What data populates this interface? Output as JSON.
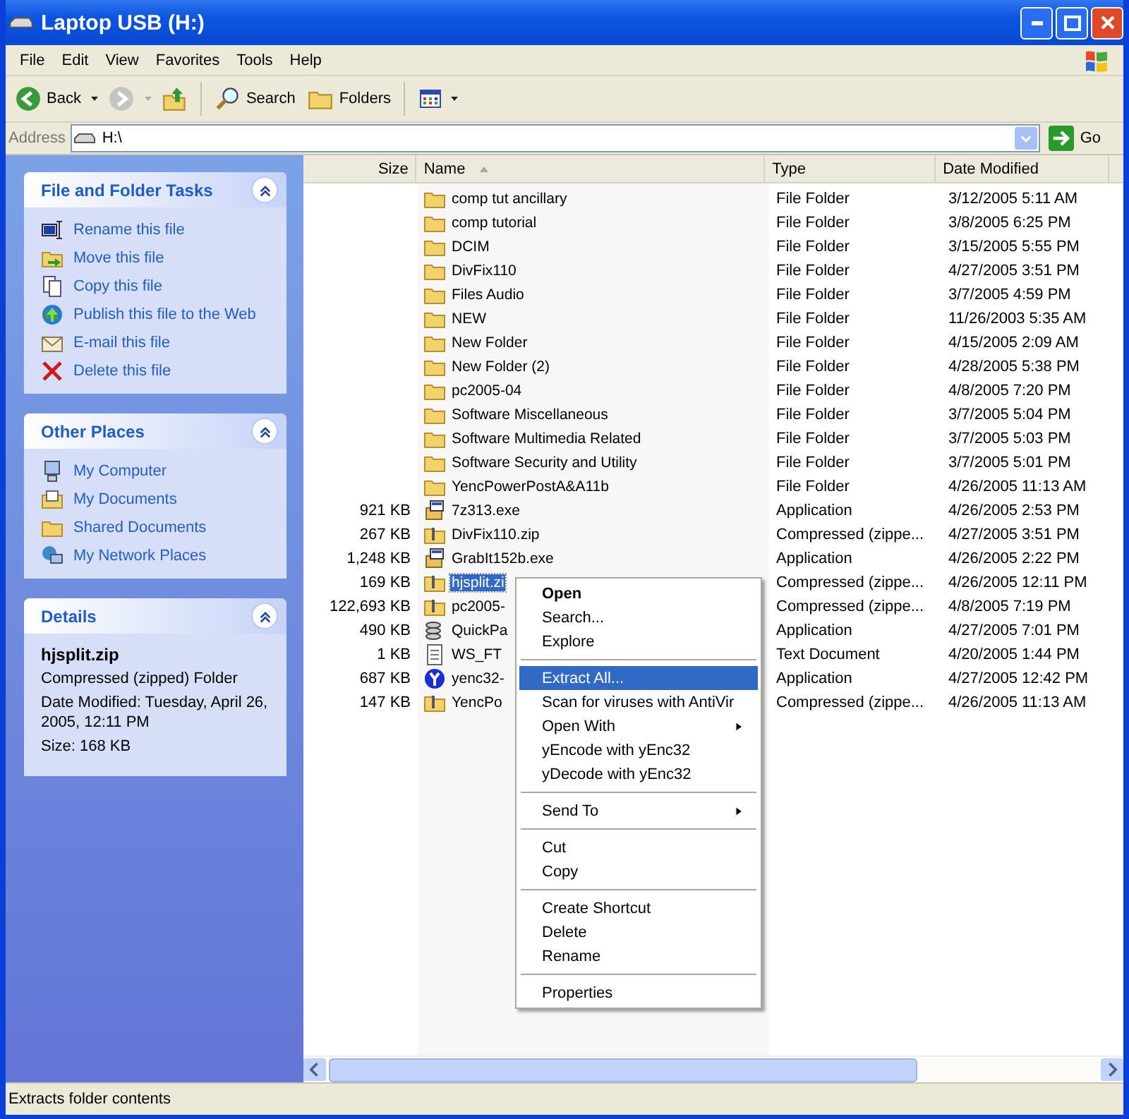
{
  "window": {
    "title": "Laptop USB (H:)"
  },
  "menu_bar": [
    "File",
    "Edit",
    "View",
    "Favorites",
    "Tools",
    "Help"
  ],
  "toolbar": {
    "back": "Back",
    "search": "Search",
    "folders": "Folders",
    "forward_disabled": true
  },
  "address": {
    "label": "Address",
    "value": "H:\\",
    "go": "Go"
  },
  "sidebar": [
    {
      "title": "File and Folder Tasks",
      "kind": "links",
      "items": [
        {
          "label": "Rename this file",
          "kind": "rename"
        },
        {
          "label": "Move this file",
          "kind": "move"
        },
        {
          "label": "Copy this file",
          "kind": "copy"
        },
        {
          "label": "Publish this file to the Web",
          "kind": "publish"
        },
        {
          "label": "E-mail this file",
          "kind": "email"
        },
        {
          "label": "Delete this file",
          "kind": "delete"
        }
      ]
    },
    {
      "title": "Other Places",
      "kind": "links",
      "items": [
        {
          "label": "My Computer",
          "kind": "computer"
        },
        {
          "label": "My Documents",
          "kind": "documents"
        },
        {
          "label": "Shared Documents",
          "kind": "folder"
        },
        {
          "label": "My Network Places",
          "kind": "network"
        }
      ]
    },
    {
      "title": "Details",
      "kind": "details",
      "name": "hjsplit.zip",
      "type": "Compressed (zipped) Folder",
      "modified": "Date Modified: Tuesday, April 26, 2005, 12:11 PM",
      "size": "Size: 168 KB"
    }
  ],
  "table": {
    "columns": [
      {
        "label": "Size",
        "sorted": false
      },
      {
        "label": "Name",
        "sorted": true
      },
      {
        "label": "Type",
        "sorted": false
      },
      {
        "label": "Date Modified",
        "sorted": false
      }
    ],
    "rows": [
      {
        "size": "",
        "name": "comp tut ancillary",
        "type": "File Folder",
        "date": "3/12/2005 5:11 AM",
        "kind": "folder",
        "selected": false
      },
      {
        "size": "",
        "name": "comp tutorial",
        "type": "File Folder",
        "date": "3/8/2005 6:25 PM",
        "kind": "folder",
        "selected": false
      },
      {
        "size": "",
        "name": "DCIM",
        "type": "File Folder",
        "date": "3/15/2005 5:55 PM",
        "kind": "folder",
        "selected": false
      },
      {
        "size": "",
        "name": "DivFix110",
        "type": "File Folder",
        "date": "4/27/2005 3:51 PM",
        "kind": "folder",
        "selected": false
      },
      {
        "size": "",
        "name": "Files Audio",
        "type": "File Folder",
        "date": "3/7/2005 4:59 PM",
        "kind": "folder",
        "selected": false
      },
      {
        "size": "",
        "name": "NEW",
        "type": "File Folder",
        "date": "11/26/2003 5:35 AM",
        "kind": "folder",
        "selected": false
      },
      {
        "size": "",
        "name": "New Folder",
        "type": "File Folder",
        "date": "4/15/2005 2:09 AM",
        "kind": "folder",
        "selected": false
      },
      {
        "size": "",
        "name": "New Folder (2)",
        "type": "File Folder",
        "date": "4/28/2005 5:38 PM",
        "kind": "folder",
        "selected": false
      },
      {
        "size": "",
        "name": "pc2005-04",
        "type": "File Folder",
        "date": "4/8/2005 7:20 PM",
        "kind": "folder",
        "selected": false
      },
      {
        "size": "",
        "name": "Software Miscellaneous",
        "type": "File Folder",
        "date": "3/7/2005 5:04 PM",
        "kind": "folder",
        "selected": false
      },
      {
        "size": "",
        "name": "Software Multimedia Related",
        "type": "File Folder",
        "date": "3/7/2005 5:03 PM",
        "kind": "folder",
        "selected": false
      },
      {
        "size": "",
        "name": "Software Security and Utility",
        "type": "File Folder",
        "date": "3/7/2005 5:01 PM",
        "kind": "folder",
        "selected": false
      },
      {
        "size": "",
        "name": "YencPowerPostA&A11b",
        "type": "File Folder",
        "date": "4/26/2005 11:13 AM",
        "kind": "folder",
        "selected": false
      },
      {
        "size": "921 KB",
        "name": "7z313.exe",
        "type": "Application",
        "date": "4/26/2005 2:53 PM",
        "kind": "installer",
        "selected": false
      },
      {
        "size": "267 KB",
        "name": "DivFix110.zip",
        "type": "Compressed (zippe...",
        "date": "4/27/2005 3:51 PM",
        "kind": "zip",
        "selected": false
      },
      {
        "size": "1,248 KB",
        "name": "GrabIt152b.exe",
        "type": "Application",
        "date": "4/26/2005 2:22 PM",
        "kind": "installer",
        "selected": false
      },
      {
        "size": "169 KB",
        "name": "hjsplit.zi",
        "type": "Compressed (zippe...",
        "date": "4/26/2005 12:11 PM",
        "kind": "zip",
        "selected": true
      },
      {
        "size": "122,693 KB",
        "name": "pc2005-",
        "type": "Compressed (zippe...",
        "date": "4/8/2005 7:19 PM",
        "kind": "zip",
        "selected": false
      },
      {
        "size": "490 KB",
        "name": "QuickPa",
        "type": "Application",
        "date": "4/27/2005 7:01 PM",
        "kind": "database",
        "selected": false
      },
      {
        "size": "1 KB",
        "name": "WS_FT",
        "type": "Text Document",
        "date": "4/20/2005 1:44 PM",
        "kind": "text",
        "selected": false
      },
      {
        "size": "687 KB",
        "name": "yenc32-",
        "type": "Application",
        "date": "4/27/2005 12:42 PM",
        "kind": "badge",
        "selected": false
      },
      {
        "size": "147 KB",
        "name": "YencPo",
        "type": "Compressed (zippe...",
        "date": "4/26/2005 11:13 AM",
        "kind": "zip",
        "selected": false
      }
    ]
  },
  "context_menu": [
    [
      {
        "label": "Open",
        "bold": true,
        "selected": false,
        "submenu": false
      },
      {
        "label": "Search...",
        "bold": false,
        "selected": false,
        "submenu": false
      },
      {
        "label": "Explore",
        "bold": false,
        "selected": false,
        "submenu": false
      }
    ],
    [
      {
        "label": "Extract All...",
        "bold": false,
        "selected": true,
        "submenu": false
      },
      {
        "label": "Scan for viruses with AntiVir",
        "bold": false,
        "selected": false,
        "submenu": false
      },
      {
        "label": "Open With",
        "bold": false,
        "selected": false,
        "submenu": true
      },
      {
        "label": "yEncode with yEnc32",
        "bold": false,
        "selected": false,
        "submenu": false
      },
      {
        "label": "yDecode with yEnc32",
        "bold": false,
        "selected": false,
        "submenu": false
      }
    ],
    [
      {
        "label": "Send To",
        "bold": false,
        "selected": false,
        "submenu": true
      }
    ],
    [
      {
        "label": "Cut",
        "bold": false,
        "selected": false,
        "submenu": false
      },
      {
        "label": "Copy",
        "bold": false,
        "selected": false,
        "submenu": false
      }
    ],
    [
      {
        "label": "Create Shortcut",
        "bold": false,
        "selected": false,
        "submenu": false
      },
      {
        "label": "Delete",
        "bold": false,
        "selected": false,
        "submenu": false
      },
      {
        "label": "Rename",
        "bold": false,
        "selected": false,
        "submenu": false
      }
    ],
    [
      {
        "label": "Properties",
        "bold": false,
        "selected": false,
        "submenu": false
      }
    ]
  ],
  "status_bar": "Extracts folder contents"
}
